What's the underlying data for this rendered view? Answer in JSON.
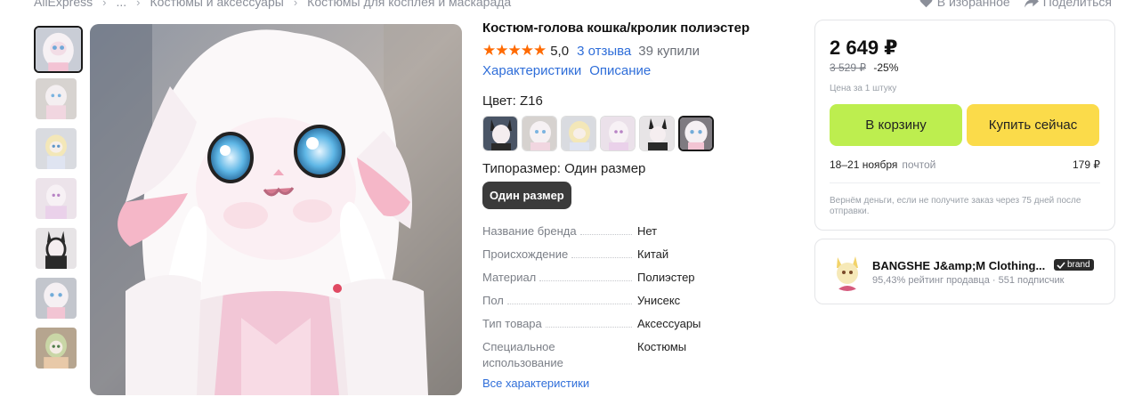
{
  "breadcrumbs": [
    "AliExpress",
    "...",
    "Костюмы и аксессуары",
    "Костюмы для косплея и маскарада"
  ],
  "top_actions": {
    "favorite": "В избранное",
    "share": "Поделиться"
  },
  "product": {
    "title": "Костюм-голова кошка/кролик полиэстер",
    "stars": "★★★★★",
    "rating": "5,0",
    "reviews": "3 отзыва",
    "bought": "39 купили",
    "links": [
      "Характеристики",
      "Описание"
    ],
    "color_label": "Цвет: Z16",
    "size_label": "Типоразмер: Один размер",
    "size_value": "Один размер",
    "specs": [
      {
        "k": "Название бренда",
        "v": "Нет"
      },
      {
        "k": "Происхождение",
        "v": "Китай"
      },
      {
        "k": "Материал",
        "v": "Полиэстер"
      },
      {
        "k": "Пол",
        "v": "Унисекс"
      },
      {
        "k": "Тип товара",
        "v": "Аксессуары"
      },
      {
        "k": "Специальное использование",
        "v": "Костюмы"
      }
    ],
    "all_specs_link": "Все характеристики"
  },
  "buybox": {
    "price": "2 649 ₽",
    "old_price": "3 529 ₽",
    "discount": "-25%",
    "unit_note": "Цена за 1 штуку",
    "cart_button": "В корзину",
    "buy_button": "Купить сейчас",
    "delivery_date": "18–21 ноября",
    "delivery_method": "почтой",
    "delivery_price": "179 ₽",
    "refund_note": "Вернём деньги, если не получите заказ через 75 дней после отправки."
  },
  "seller": {
    "name": "BANGSHE J&amp;M Clothing...",
    "badge": "brand",
    "meta": "95,43% рейтинг продавца · 551 подписчик"
  },
  "colors": {
    "price_text": "#111111",
    "link": "#2f6ed9",
    "star": "#ff6a00",
    "cart_button": "#bdee4f",
    "buy_button": "#fbdb4a",
    "size_button": "#3b3b3b"
  }
}
